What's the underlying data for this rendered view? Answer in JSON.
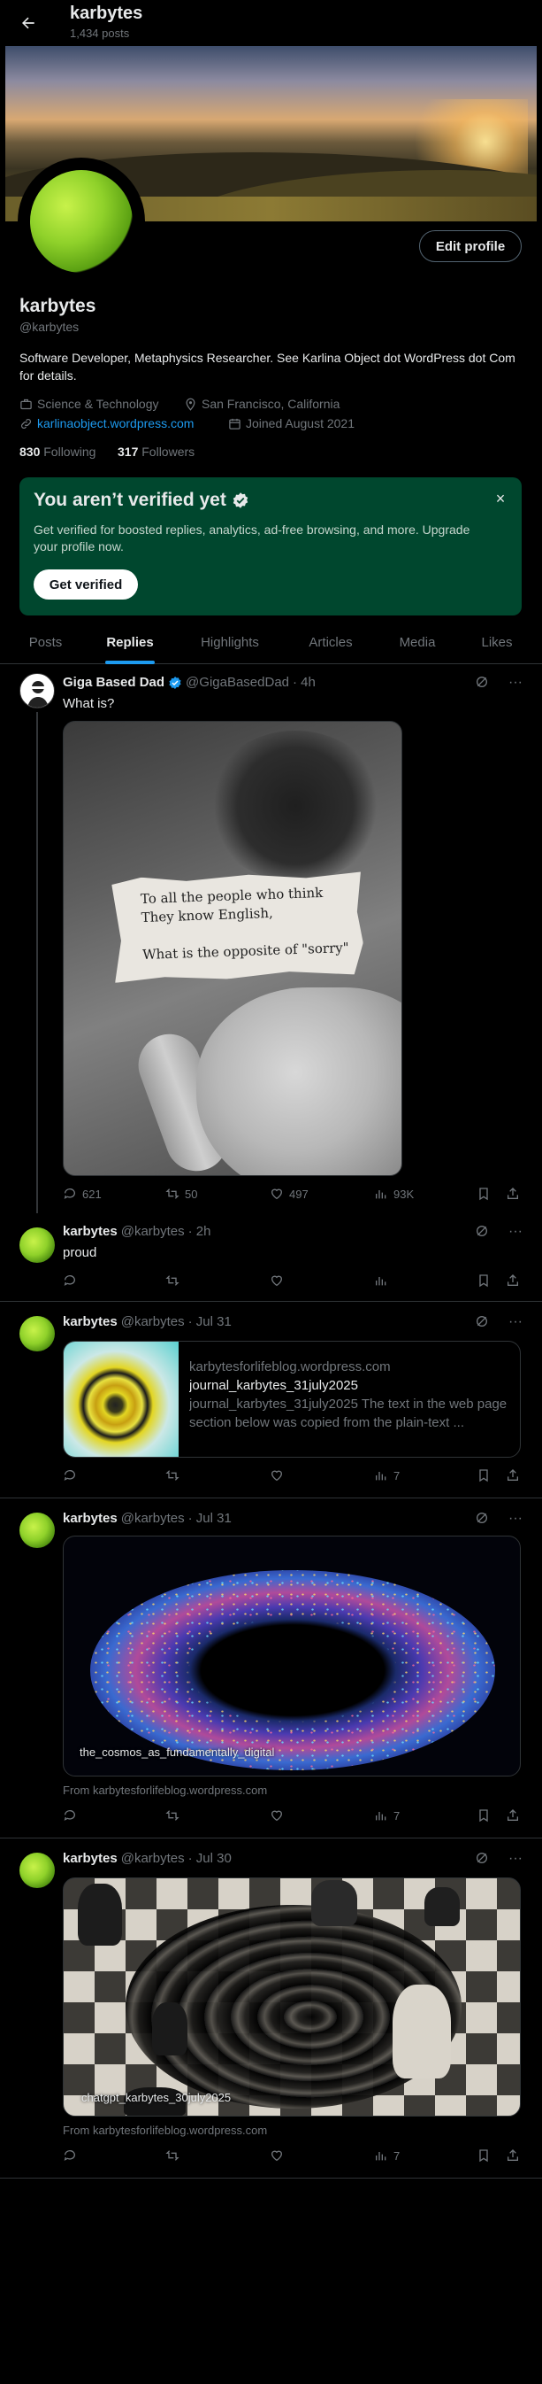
{
  "header": {
    "name": "karbytes",
    "post_count": "1,434 posts"
  },
  "profile": {
    "name": "karbytes",
    "handle": "@karbytes",
    "edit_label": "Edit profile",
    "bio": "Software Developer, Metaphysics Researcher. See Karlina Object dot WordPress dot Com for details.",
    "category": "Science & Technology",
    "location": "San Francisco, California",
    "website": "karlinaobject.wordpress.com",
    "joined": "Joined August 2021",
    "following_count": "830",
    "following_label": "Following",
    "followers_count": "317",
    "followers_label": "Followers"
  },
  "verify_card": {
    "title": "You aren’t verified yet",
    "description": "Get verified for boosted replies, analytics, ad-free browsing, and more. Upgrade your profile now.",
    "button": "Get verified",
    "close": "×"
  },
  "tabs": [
    {
      "label": "Posts"
    },
    {
      "label": "Replies",
      "active": true
    },
    {
      "label": "Highlights"
    },
    {
      "label": "Articles"
    },
    {
      "label": "Media"
    },
    {
      "label": "Likes"
    }
  ],
  "posts": [
    {
      "author": "Giga Based Dad",
      "handle": "@GigaBasedDad",
      "time": "· 4h",
      "text": "What is?",
      "image_text": "To all the people who think\nThey know English,\n\nWhat is the opposite of \"sorry\"",
      "replies": "621",
      "reposts": "50",
      "likes": "497",
      "views": "93K"
    },
    {
      "author": "karbytes",
      "handle": "@karbytes",
      "time": "· 2h",
      "text": "proud",
      "replies": "",
      "reposts": "",
      "likes": "",
      "views": ""
    },
    {
      "author": "karbytes",
      "handle": "@karbytes",
      "time": "· Jul 31",
      "card": {
        "domain": "karbytesforlifeblog.wordpress.com",
        "title": "journal_karbytes_31july2025",
        "description": "journal_karbytes_31july2025 The text in the web page section below was copied from the plain-text ..."
      },
      "replies": "",
      "reposts": "",
      "likes": "",
      "views": "7"
    },
    {
      "author": "karbytes",
      "handle": "@karbytes",
      "time": "· Jul 31",
      "image_label": "the_cosmos_as_fundamentally_digital",
      "from": "From karbytesforlifeblog.wordpress.com",
      "replies": "",
      "reposts": "",
      "likes": "",
      "views": "7"
    },
    {
      "author": "karbytes",
      "handle": "@karbytes",
      "time": "· Jul 30",
      "image_label": "chatgpt_karbytes_30july2025",
      "from": "From karbytesforlifeblog.wordpress.com",
      "replies": "",
      "reposts": "",
      "likes": "",
      "views": "7"
    }
  ],
  "colors": {
    "accent": "#1d9bf0",
    "verify_bg": "#00472e",
    "muted": "#71767b",
    "border": "#2f3336"
  }
}
